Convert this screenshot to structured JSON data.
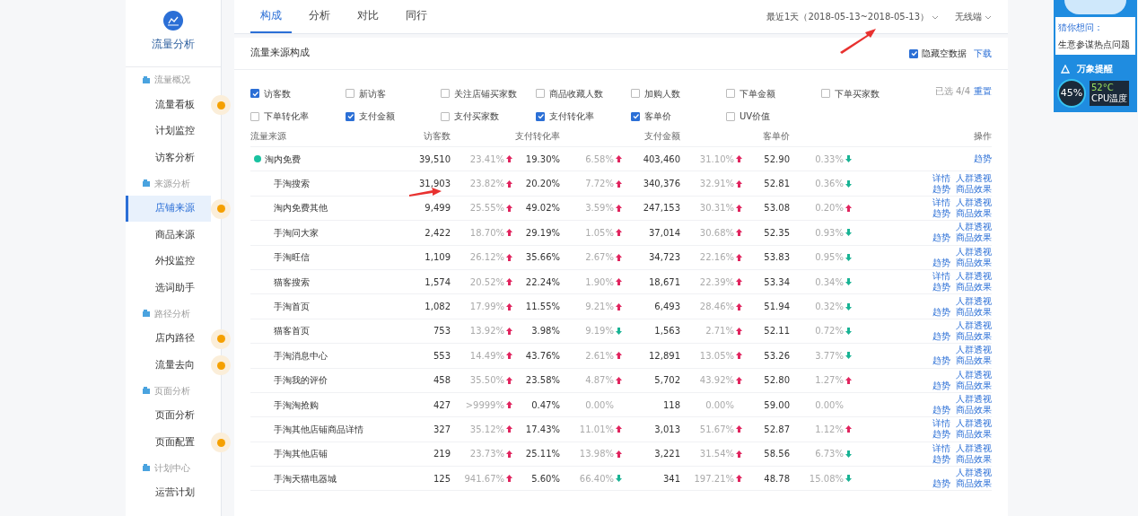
{
  "sidebar": {
    "title": "流量分析",
    "groups": [
      {
        "label": "流量概况",
        "items": [
          {
            "label": "流量看板",
            "selected": false,
            "badge": true
          },
          {
            "label": "计划监控",
            "selected": false,
            "badge": false
          },
          {
            "label": "访客分析",
            "selected": false,
            "badge": false
          }
        ]
      },
      {
        "label": "来源分析",
        "items": [
          {
            "label": "店铺来源",
            "selected": true,
            "badge": true
          },
          {
            "label": "商品来源",
            "selected": false,
            "badge": false
          },
          {
            "label": "外投监控",
            "selected": false,
            "badge": false
          },
          {
            "label": "选词助手",
            "selected": false,
            "badge": false
          }
        ]
      },
      {
        "label": "路径分析",
        "items": [
          {
            "label": "店内路径",
            "selected": false,
            "badge": true
          },
          {
            "label": "流量去向",
            "selected": false,
            "badge": true
          }
        ]
      },
      {
        "label": "页面分析",
        "items": [
          {
            "label": "页面分析",
            "selected": false,
            "badge": false
          },
          {
            "label": "页面配置",
            "selected": false,
            "badge": true
          }
        ]
      },
      {
        "label": "计划中心",
        "items": [
          {
            "label": "运营计划",
            "selected": false,
            "badge": false
          }
        ]
      }
    ]
  },
  "tabs": [
    {
      "label": "构成",
      "selected": true
    },
    {
      "label": "分析",
      "selected": false
    },
    {
      "label": "对比",
      "selected": false
    },
    {
      "label": "同行",
      "selected": false
    }
  ],
  "date_range": "最近1天（2018-05-13~2018-05-13）",
  "device": "无线端",
  "card": {
    "title": "流量来源构成",
    "hide_empty": {
      "label": "隐藏空数据",
      "checked": true
    },
    "download": "下载",
    "metrics": [
      {
        "label": "访客数",
        "checked": true
      },
      {
        "label": "新访客",
        "checked": false
      },
      {
        "label": "关注店铺买家数",
        "checked": false
      },
      {
        "label": "商品收藏人数",
        "checked": false
      },
      {
        "label": "加购人数",
        "checked": false
      },
      {
        "label": "下单金额",
        "checked": false
      },
      {
        "label": "下单买家数",
        "checked": false
      },
      {
        "label": "下单转化率",
        "checked": false
      },
      {
        "label": "支付金额",
        "checked": true
      },
      {
        "label": "支付买家数",
        "checked": false
      },
      {
        "label": "支付转化率",
        "checked": true
      },
      {
        "label": "客单价",
        "checked": true
      },
      {
        "label": "UV价值",
        "checked": false
      }
    ],
    "selected_count": "已选 4/4",
    "reset": "重置"
  },
  "table": {
    "columns": [
      "流量来源",
      "访客数",
      "支付转化率",
      "支付金额",
      "客单价",
      "操作"
    ],
    "rows": [
      {
        "cells": [
          {
            "value": "淘内免费"
          },
          {
            "value": "39,510",
            "change": "23.41%",
            "kind": "up"
          },
          {
            "value": "19.30%",
            "change": "6.58%",
            "kind": "up"
          },
          {
            "value": "403,460",
            "change": "31.10%",
            "kind": "up"
          },
          {
            "value": "52.90",
            "change": "0.33%",
            "kind": "down"
          },
          {
            "actions": [
              [
                "趋势"
              ]
            ]
          }
        ],
        "children": [
          {
            "cells": [
              {
                "value": "手淘搜索"
              },
              {
                "value": "31,903",
                "change": "23.82%",
                "kind": "up"
              },
              {
                "value": "20.20%",
                "change": "7.72%",
                "kind": "up"
              },
              {
                "value": "340,376",
                "change": "32.91%",
                "kind": "up"
              },
              {
                "value": "52.81",
                "change": "0.36%",
                "kind": "down"
              },
              {
                "actions": [
                  [
                    "详情",
                    "人群透视"
                  ],
                  [
                    "趋势",
                    "商品效果"
                  ]
                ]
              }
            ]
          },
          {
            "cells": [
              {
                "value": "淘内免费其他"
              },
              {
                "value": "9,499",
                "change": "25.55%",
                "kind": "up"
              },
              {
                "value": "49.02%",
                "change": "3.59%",
                "kind": "up"
              },
              {
                "value": "247,153",
                "change": "30.31%",
                "kind": "up"
              },
              {
                "value": "53.08",
                "change": "0.20%",
                "kind": "up"
              },
              {
                "actions": [
                  [
                    "详情",
                    "人群透视"
                  ],
                  [
                    "趋势",
                    "商品效果"
                  ]
                ]
              }
            ]
          },
          {
            "cells": [
              {
                "value": "手淘问大家"
              },
              {
                "value": "2,422",
                "change": "18.70%",
                "kind": "up"
              },
              {
                "value": "29.19%",
                "change": "1.05%",
                "kind": "up"
              },
              {
                "value": "37,014",
                "change": "30.68%",
                "kind": "up"
              },
              {
                "value": "52.35",
                "change": "0.93%",
                "kind": "down"
              },
              {
                "actions": [
                  [
                    "人群透视"
                  ],
                  [
                    "趋势",
                    "商品效果"
                  ]
                ]
              }
            ]
          },
          {
            "cells": [
              {
                "value": "手淘旺信"
              },
              {
                "value": "1,109",
                "change": "26.12%",
                "kind": "up"
              },
              {
                "value": "35.66%",
                "change": "2.67%",
                "kind": "up"
              },
              {
                "value": "34,723",
                "change": "22.16%",
                "kind": "up"
              },
              {
                "value": "53.83",
                "change": "0.95%",
                "kind": "down"
              },
              {
                "actions": [
                  [
                    "人群透视"
                  ],
                  [
                    "趋势",
                    "商品效果"
                  ]
                ]
              }
            ]
          },
          {
            "cells": [
              {
                "value": "猫客搜索"
              },
              {
                "value": "1,574",
                "change": "20.52%",
                "kind": "up"
              },
              {
                "value": "22.24%",
                "change": "1.90%",
                "kind": "up"
              },
              {
                "value": "18,671",
                "change": "22.39%",
                "kind": "up"
              },
              {
                "value": "53.34",
                "change": "0.34%",
                "kind": "down"
              },
              {
                "actions": [
                  [
                    "详情",
                    "人群透视"
                  ],
                  [
                    "趋势",
                    "商品效果"
                  ]
                ]
              }
            ]
          },
          {
            "cells": [
              {
                "value": "手淘首页"
              },
              {
                "value": "1,082",
                "change": "17.99%",
                "kind": "up"
              },
              {
                "value": "11.55%",
                "change": "9.21%",
                "kind": "up"
              },
              {
                "value": "6,493",
                "change": "28.46%",
                "kind": "up"
              },
              {
                "value": "51.94",
                "change": "0.32%",
                "kind": "down"
              },
              {
                "actions": [
                  [
                    "人群透视"
                  ],
                  [
                    "趋势",
                    "商品效果"
                  ]
                ]
              }
            ]
          },
          {
            "cells": [
              {
                "value": "猫客首页"
              },
              {
                "value": "753",
                "change": "13.92%",
                "kind": "up"
              },
              {
                "value": "3.98%",
                "change": "9.19%",
                "kind": "down"
              },
              {
                "value": "1,563",
                "change": "2.71%",
                "kind": "up"
              },
              {
                "value": "52.11",
                "change": "0.72%",
                "kind": "down"
              },
              {
                "actions": [
                  [
                    "人群透视"
                  ],
                  [
                    "趋势",
                    "商品效果"
                  ]
                ]
              }
            ]
          },
          {
            "cells": [
              {
                "value": "手淘消息中心"
              },
              {
                "value": "553",
                "change": "14.49%",
                "kind": "up"
              },
              {
                "value": "43.76%",
                "change": "2.61%",
                "kind": "up"
              },
              {
                "value": "12,891",
                "change": "13.05%",
                "kind": "up"
              },
              {
                "value": "53.26",
                "change": "3.77%",
                "kind": "down"
              },
              {
                "actions": [
                  [
                    "人群透视"
                  ],
                  [
                    "趋势",
                    "商品效果"
                  ]
                ]
              }
            ]
          },
          {
            "cells": [
              {
                "value": "手淘我的评价"
              },
              {
                "value": "458",
                "change": "35.50%",
                "kind": "up"
              },
              {
                "value": "23.58%",
                "change": "4.87%",
                "kind": "up"
              },
              {
                "value": "5,702",
                "change": "43.92%",
                "kind": "up"
              },
              {
                "value": "52.80",
                "change": "1.27%",
                "kind": "up"
              },
              {
                "actions": [
                  [
                    "人群透视"
                  ],
                  [
                    "趋势",
                    "商品效果"
                  ]
                ]
              }
            ]
          },
          {
            "cells": [
              {
                "value": "手淘淘抢购"
              },
              {
                "value": "427",
                "change": ">9999%",
                "kind": "up"
              },
              {
                "value": "0.47%",
                "change": "0.00%",
                "kind": "flat"
              },
              {
                "value": "118",
                "change": "0.00%",
                "kind": "flat"
              },
              {
                "value": "59.00",
                "change": "0.00%",
                "kind": "flat"
              },
              {
                "actions": [
                  [
                    "人群透视"
                  ],
                  [
                    "趋势",
                    "商品效果"
                  ]
                ]
              }
            ]
          },
          {
            "cells": [
              {
                "value": "手淘其他店铺商品详情"
              },
              {
                "value": "327",
                "change": "35.12%",
                "kind": "up"
              },
              {
                "value": "17.43%",
                "change": "11.01%",
                "kind": "up"
              },
              {
                "value": "3,013",
                "change": "51.67%",
                "kind": "up"
              },
              {
                "value": "52.87",
                "change": "1.12%",
                "kind": "up"
              },
              {
                "actions": [
                  [
                    "详情",
                    "人群透视"
                  ],
                  [
                    "趋势",
                    "商品效果"
                  ]
                ]
              }
            ]
          },
          {
            "cells": [
              {
                "value": "手淘其他店铺"
              },
              {
                "value": "219",
                "change": "23.73%",
                "kind": "up"
              },
              {
                "value": "25.11%",
                "change": "13.98%",
                "kind": "up"
              },
              {
                "value": "3,221",
                "change": "31.54%",
                "kind": "up"
              },
              {
                "value": "58.56",
                "change": "6.73%",
                "kind": "down"
              },
              {
                "actions": [
                  [
                    "详情",
                    "人群透视"
                  ],
                  [
                    "趋势",
                    "商品效果"
                  ]
                ]
              }
            ]
          },
          {
            "cells": [
              {
                "value": "手淘天猫电器城"
              },
              {
                "value": "125",
                "change": "941.67%",
                "kind": "up"
              },
              {
                "value": "5.60%",
                "change": "66.40%",
                "kind": "down"
              },
              {
                "value": "341",
                "change": "197.21%",
                "kind": "up"
              },
              {
                "value": "48.78",
                "change": "15.08%",
                "kind": "down"
              },
              {
                "actions": [
                  [
                    "人群透视"
                  ],
                  [
                    "趋势",
                    "商品效果"
                  ]
                ]
              }
            ]
          }
        ]
      }
    ]
  },
  "widget": {
    "question_title": "猜你想问：",
    "question": "生意参谋热点问题",
    "reminder": "万象提醒",
    "cpu_load": "45",
    "cpu_unit": "%",
    "temperature": "52°C",
    "temperature_label": "CPU温度"
  }
}
